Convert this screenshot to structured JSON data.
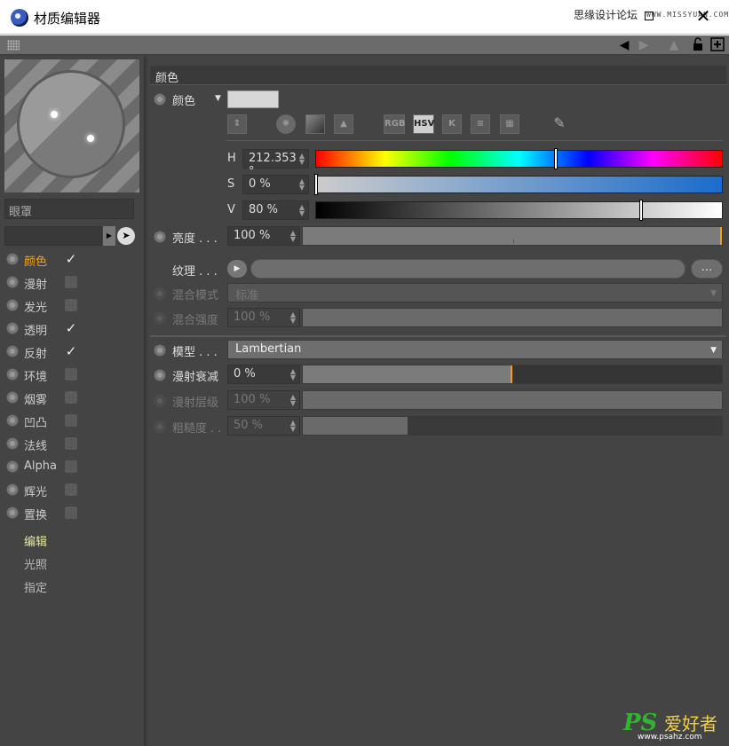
{
  "window": {
    "title": "材质编辑器",
    "watermark": "思缘设计论坛",
    "watermark_url": "WWW.MISSYUAN.COM",
    "close_glyph": "✕"
  },
  "left": {
    "material_name": "眼罩",
    "channels": [
      {
        "label": "颜色",
        "checked": true,
        "active": true
      },
      {
        "label": "漫射",
        "checked": false
      },
      {
        "label": "发光",
        "checked": false
      },
      {
        "label": "透明",
        "checked": true
      },
      {
        "label": "反射",
        "checked": true
      },
      {
        "label": "环境",
        "checked": false
      },
      {
        "label": "烟雾",
        "checked": false
      },
      {
        "label": "凹凸",
        "checked": false
      },
      {
        "label": "法线",
        "checked": false
      },
      {
        "label": "Alpha",
        "checked": false
      },
      {
        "label": "辉光",
        "checked": false
      },
      {
        "label": "置换",
        "checked": false
      }
    ],
    "sub_items": [
      "编辑",
      "光照",
      "指定"
    ],
    "check_glyph": "✓"
  },
  "right": {
    "section_title": "颜色",
    "color_label": "颜色",
    "color_mode_buttons": [
      "RGB",
      "HSV",
      "K"
    ],
    "hsv": {
      "h_label": "H",
      "h_value": "212.353 °",
      "h_level": 0.59,
      "s_label": "S",
      "s_value": "0 %",
      "s_level": 0.0,
      "v_label": "V",
      "v_value": "80 %",
      "v_level": 0.8
    },
    "brightness": {
      "label": "亮度 . . .",
      "value": "100 %",
      "level": 1.0
    },
    "texture": {
      "label": "纹理 . . .",
      "dots": "..."
    },
    "blend_mode": {
      "label": "混合模式",
      "value": "标准"
    },
    "blend_strength": {
      "label": "混合强度",
      "value": "100 %"
    },
    "model": {
      "label": "模型 . . .",
      "value": "Lambertian"
    },
    "diffuse_falloff": {
      "label": "漫射衰减",
      "value": "0 %",
      "level": 0.5
    },
    "diffuse_level": {
      "label": "漫射层级",
      "value": "100 %"
    },
    "roughness": {
      "label": "粗糙度 . .",
      "value": "50 %",
      "level": 0.25
    }
  },
  "footer": {
    "logo": "PS",
    "logo_cn": "爱好者",
    "logo_url": "www.psahz.com"
  },
  "colors": {
    "accent": "#f0a020",
    "panel": "#444444",
    "swatch": "#d7d7d7"
  }
}
